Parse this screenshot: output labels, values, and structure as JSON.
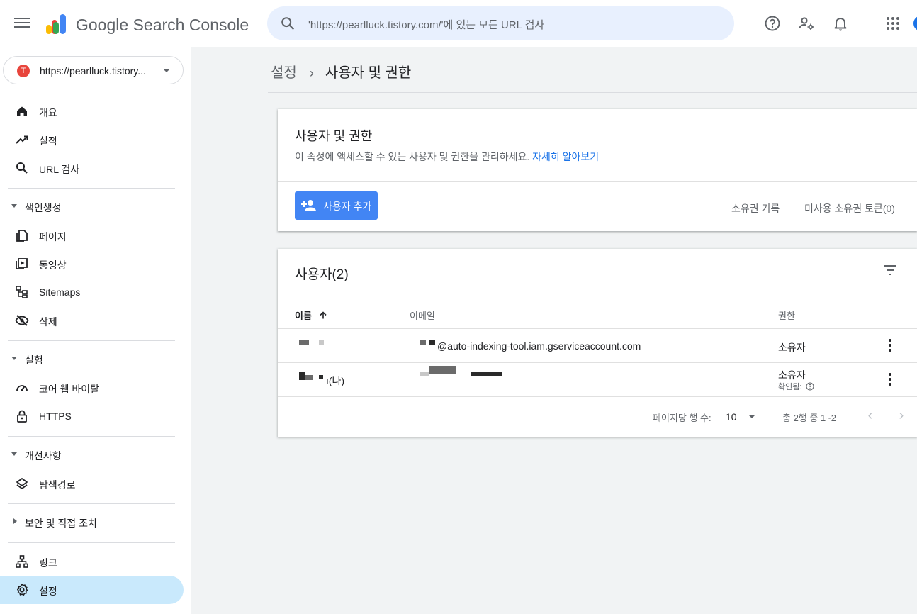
{
  "app": {
    "brand": "Google Search Console"
  },
  "search": {
    "placeholder": "'https://pearlluck.tistory.com/'에 있는 모든 URL 검사"
  },
  "property": {
    "label": "https://pearlluck.tistory...",
    "favicon_letter": "T"
  },
  "sidebar": {
    "top_items": [
      {
        "label": "개요",
        "icon": "home-icon"
      },
      {
        "label": "실적",
        "icon": "trending-up-icon"
      },
      {
        "label": "URL 검사",
        "icon": "search-icon"
      }
    ],
    "sections": [
      {
        "label": "색인생성",
        "expanded": true,
        "items": [
          {
            "label": "페이지",
            "icon": "pages-icon"
          },
          {
            "label": "동영상",
            "icon": "video-icon"
          },
          {
            "label": "Sitemaps",
            "icon": "sitemap-icon"
          },
          {
            "label": "삭제",
            "icon": "visibility-off-icon"
          }
        ]
      },
      {
        "label": "실험",
        "expanded": true,
        "items": [
          {
            "label": "코어 웹 바이탈",
            "icon": "speed-icon"
          },
          {
            "label": "HTTPS",
            "icon": "lock-icon"
          }
        ]
      },
      {
        "label": "개선사항",
        "expanded": true,
        "items": [
          {
            "label": "탐색경로",
            "icon": "layers-icon"
          }
        ]
      },
      {
        "label": "보안 및 직접 조치",
        "expanded": false,
        "items": []
      }
    ],
    "bottom_items": [
      {
        "label": "링크",
        "icon": "link-tree-icon"
      },
      {
        "label": "설정",
        "icon": "gear-icon",
        "active": true
      }
    ]
  },
  "breadcrumb": {
    "parent": "설정",
    "separator": "›",
    "current": "사용자 및 권한"
  },
  "permissions_card": {
    "title": "사용자 및 권한",
    "description": "이 속성에 액세스할 수 있는 사용자 및 권한을 관리하세요.",
    "learn_more": "자세히 알아보기",
    "add_user_label": "사용자 추가",
    "ownership_history": "소유권 기록",
    "unused_tokens": "미사용 소유권 토큰(0)"
  },
  "users_card": {
    "title": "사용자(2)",
    "columns": {
      "name": "이름",
      "email": "이메일",
      "permission": "권한"
    },
    "rows": [
      {
        "name": "",
        "email": "@auto-indexing-tool.iam.gserviceaccount.com",
        "permission": "소유자",
        "note": ""
      },
      {
        "name": "ı(나)",
        "email": "",
        "permission": "소유자",
        "note": "확인됨:"
      }
    ],
    "pager": {
      "rows_per_page_label": "페이지당 행 수:",
      "rows_per_page": "10",
      "range": "총 2행 중 1~2"
    }
  },
  "colors": {
    "accent": "#1a73e8",
    "button": "#4285f4",
    "active_nav": "#c9e9fc"
  }
}
